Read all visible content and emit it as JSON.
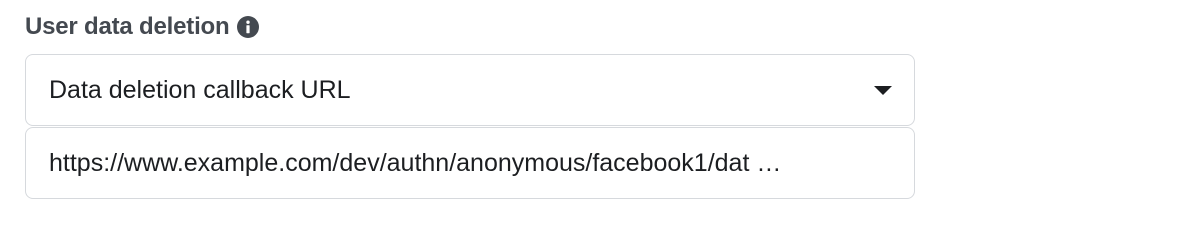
{
  "section": {
    "title": "User data deletion",
    "info_icon": "info-circle-icon"
  },
  "dropdown": {
    "selected": "Data deletion callback URL",
    "icon": "caret-down-icon"
  },
  "url_field": {
    "value": "https://www.example.com/dev/authn/anonymous/facebook1/dat …"
  },
  "colors": {
    "title": "#444950",
    "text": "#1c1e21",
    "border": "#d6d9dd",
    "icon": "#444950"
  }
}
